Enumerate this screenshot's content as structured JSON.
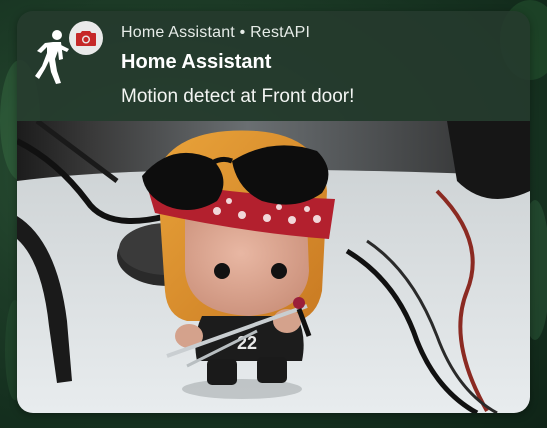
{
  "notification": {
    "app_name": "Home Assistant",
    "separator": "•",
    "source": "RestAPI",
    "title": "Home Assistant",
    "message": "Motion detect at Front door!",
    "icon": "walking-person-icon",
    "badge_icon": "camera-icon"
  },
  "image": {
    "subject": "snapshot-photo"
  },
  "colors": {
    "card_background": "#263a2e",
    "badge_background": "#e9e9e9",
    "badge_icon": "#c62828",
    "bandana": "#b3202e",
    "wallpaper": "#1e3d28"
  }
}
